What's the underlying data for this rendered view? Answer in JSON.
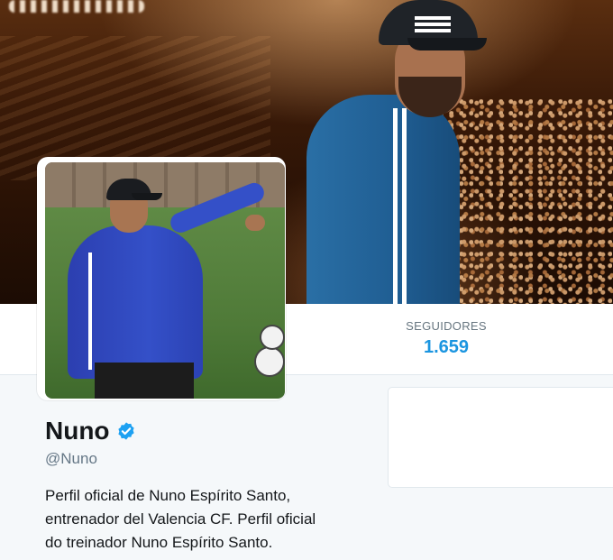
{
  "profile": {
    "name": "Nuno",
    "handle": "@Nuno",
    "bio_lines": [
      "Perfil oficial de Nuno Espírito Santo,",
      "entrenador del Valencia CF. Perfil oficial",
      "do treinador Nuno Espírito Santo."
    ],
    "verified_icon": "verified-badge-icon"
  },
  "stats": {
    "followers_label": "SEGUIDORES",
    "followers_value": "1.659"
  },
  "colors": {
    "accent": "#1b95e0",
    "verified": "#1da1f2",
    "name_text": "#14171a",
    "secondary_text": "#657786",
    "page_bg": "#f5f8fa"
  }
}
